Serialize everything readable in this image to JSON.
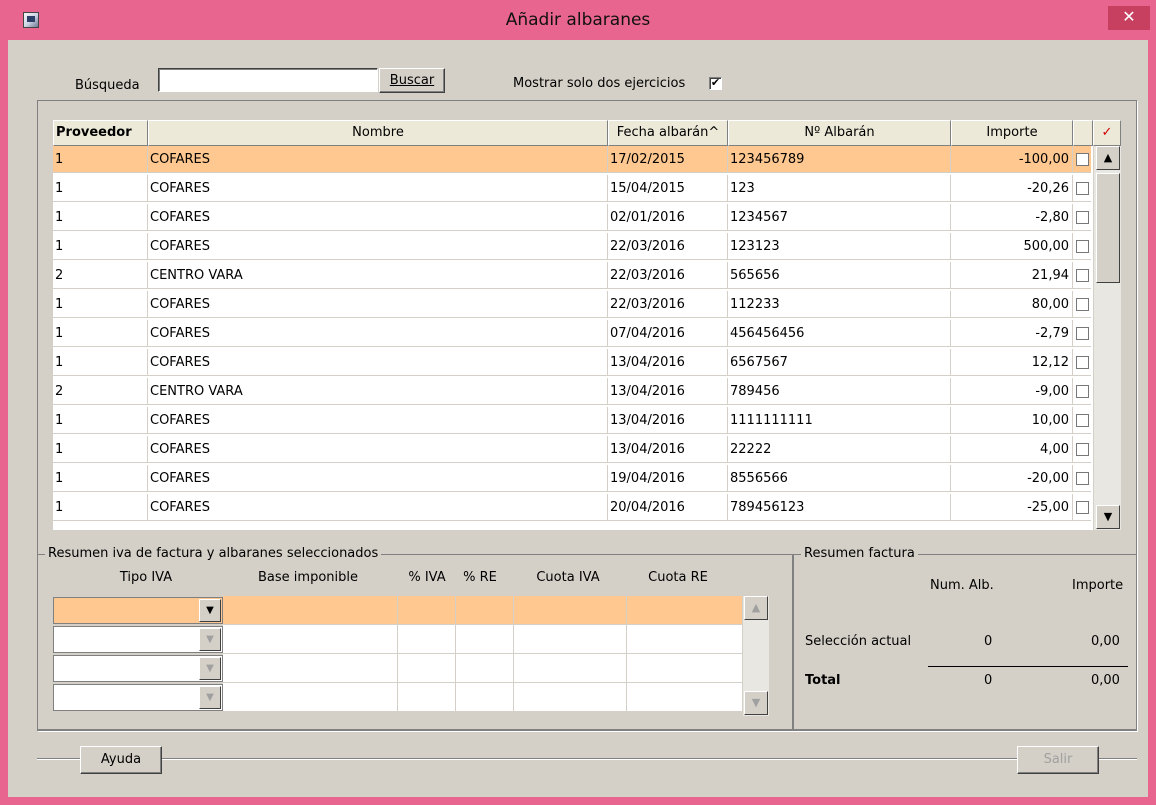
{
  "window": {
    "title": "Añadir albaranes",
    "close_glyph": "✕"
  },
  "search": {
    "label": "Búsqueda",
    "value": "",
    "button_label": "Buscar",
    "mostrar_label": "Mostrar solo dos ejercicios",
    "mostrar_checked": true
  },
  "table": {
    "headers": {
      "proveedor": "Proveedor",
      "nombre": "Nombre",
      "fecha": "Fecha albarán^",
      "numero": "Nº Albarán",
      "importe": "Importe"
    },
    "rows": [
      {
        "proveedor": "1",
        "nombre": "COFARES",
        "fecha": "17/02/2015",
        "numero": "123456789",
        "importe": "-100,00",
        "selected": true
      },
      {
        "proveedor": "1",
        "nombre": "COFARES",
        "fecha": "15/04/2015",
        "numero": "123",
        "importe": "-20,26"
      },
      {
        "proveedor": "1",
        "nombre": "COFARES",
        "fecha": "02/01/2016",
        "numero": "1234567",
        "importe": "-2,80"
      },
      {
        "proveedor": "1",
        "nombre": "COFARES",
        "fecha": "22/03/2016",
        "numero": "123123",
        "importe": "500,00"
      },
      {
        "proveedor": "2",
        "nombre": "CENTRO VARA",
        "fecha": "22/03/2016",
        "numero": "565656",
        "importe": "21,94"
      },
      {
        "proveedor": "1",
        "nombre": "COFARES",
        "fecha": "22/03/2016",
        "numero": "112233",
        "importe": "80,00"
      },
      {
        "proveedor": "1",
        "nombre": "COFARES",
        "fecha": "07/04/2016",
        "numero": "456456456",
        "importe": "-2,79"
      },
      {
        "proveedor": "1",
        "nombre": "COFARES",
        "fecha": "13/04/2016",
        "numero": "6567567",
        "importe": "12,12"
      },
      {
        "proveedor": "2",
        "nombre": "CENTRO VARA",
        "fecha": "13/04/2016",
        "numero": "789456",
        "importe": "-9,00"
      },
      {
        "proveedor": "1",
        "nombre": "COFARES",
        "fecha": "13/04/2016",
        "numero": "1111111111",
        "importe": "10,00"
      },
      {
        "proveedor": "1",
        "nombre": "COFARES",
        "fecha": "13/04/2016",
        "numero": "22222",
        "importe": "4,00"
      },
      {
        "proveedor": "1",
        "nombre": "COFARES",
        "fecha": "19/04/2016",
        "numero": "8556566",
        "importe": "-20,00"
      },
      {
        "proveedor": "1",
        "nombre": "COFARES",
        "fecha": "20/04/2016",
        "numero": "789456123",
        "importe": "-25,00"
      }
    ]
  },
  "resumen_iva": {
    "title": "Resumen iva de factura y albaranes seleccionados",
    "headers": [
      "Tipo IVA",
      "Base imponible",
      "% IVA",
      "% RE",
      "Cuota IVA",
      "Cuota RE"
    ]
  },
  "resumen_factura": {
    "title": "Resumen factura",
    "col_num": "Num. Alb.",
    "col_importe": "Importe",
    "seleccion_label": "Selección actual",
    "seleccion_num": "0",
    "seleccion_importe": "0,00",
    "total_label": "Total",
    "total_num": "0",
    "total_importe": "0,00"
  },
  "buttons": {
    "help": "Ayuda",
    "exit": "Salir"
  },
  "colors": {
    "titlebar": "#e8658f",
    "selection": "#ffc890",
    "face": "#d4d0c8"
  }
}
